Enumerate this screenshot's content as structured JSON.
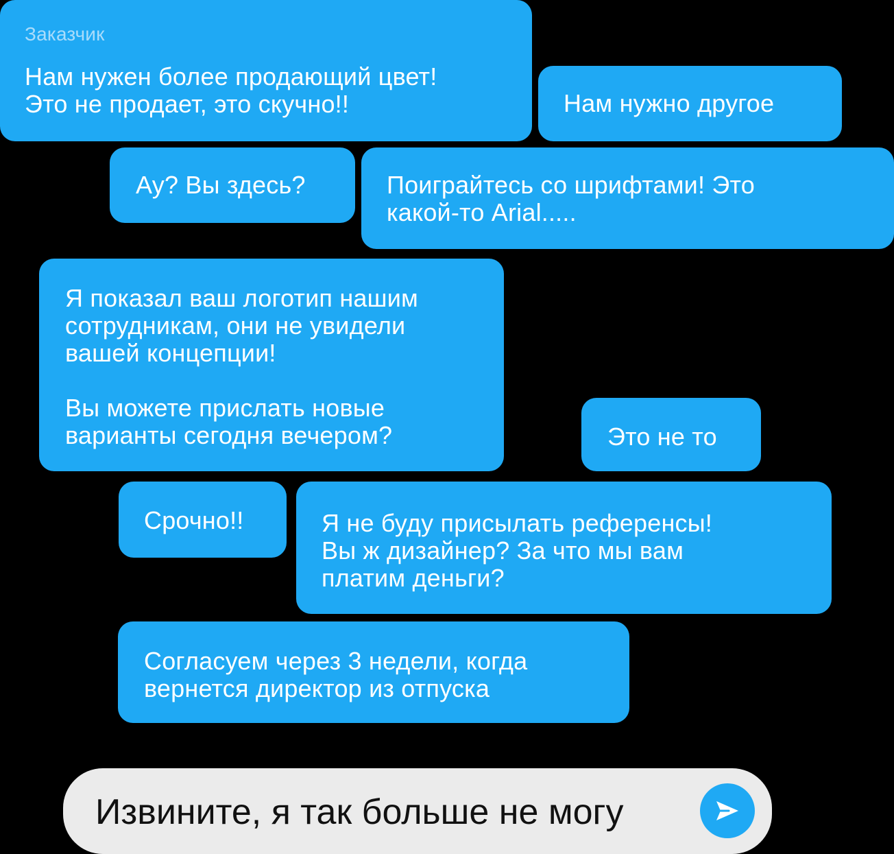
{
  "colors": {
    "background": "#000000",
    "bubble": "#1fa9f4",
    "bubble_text": "#ffffff",
    "sender_label": "#a9dcfb",
    "composer_bg": "#ebebeb",
    "composer_text": "#111111",
    "send_button": "#1fa9f4"
  },
  "messages": [
    {
      "sender": "Заказчик",
      "lines": [
        "Нам нужен более продающий цвет!",
        "Это не продает, это скучно!!"
      ]
    },
    {
      "lines": [
        "Нам нужно другое"
      ]
    },
    {
      "lines": [
        "Ау? Вы здесь?"
      ]
    },
    {
      "lines": [
        "Поиграйтесь со шрифтами! Это",
        "какой-то Arial....."
      ]
    },
    {
      "lines": [
        "Я показал ваш логотип нашим",
        "сотрудникам, они не увидели",
        "вашей концепции!"
      ],
      "lines2": [
        "Вы можете прислать новые",
        "варианты сегодня вечером?"
      ]
    },
    {
      "lines": [
        "Это не то"
      ]
    },
    {
      "lines": [
        "Срочно!!"
      ]
    },
    {
      "lines": [
        "Я не буду присылать референсы!",
        "Вы ж дизайнер? За что мы вам",
        "платим деньги?"
      ]
    },
    {
      "lines": [
        "Согласуем через 3 недели, когда",
        "вернется директор из отпуска"
      ]
    }
  ],
  "composer": {
    "text": "Извините, я так больше не могу",
    "send_icon": "send-arrow-icon"
  }
}
